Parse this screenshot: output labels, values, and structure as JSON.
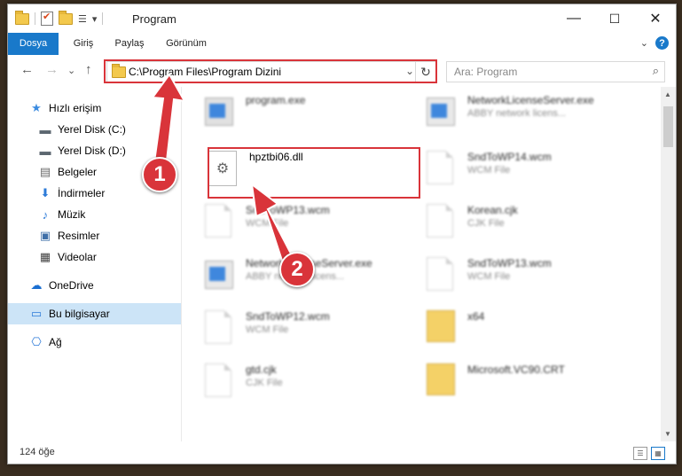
{
  "window": {
    "title": "Program",
    "controls": {
      "minimize": "—",
      "maximize": "☐",
      "close": "✕"
    }
  },
  "qat": {
    "dropdown": "▾"
  },
  "ribbon": {
    "tabs": [
      "Dosya",
      "Giriş",
      "Paylaş",
      "Görünüm"
    ],
    "collapse": "⌄",
    "help": "?"
  },
  "nav": {
    "back": "←",
    "forward": "→",
    "recent": "⌄",
    "up": "↑",
    "address": "C:\\Program Files\\Program Dizini",
    "address_dropdown": "⌄",
    "refresh": "↻",
    "search_placeholder": "Ara: Program",
    "search_icon": "search-icon"
  },
  "sidebar": {
    "items": [
      {
        "label": "Hızlı erişim",
        "icon": "star-icon",
        "glyph": "★",
        "color": "#3b8be0",
        "pinned": false
      },
      {
        "label": "Yerel Disk (C:)",
        "icon": "drive-icon",
        "glyph": "▬",
        "color": "#5c6770",
        "pinned": true
      },
      {
        "label": "Yerel Disk (D:)",
        "icon": "drive-icon",
        "glyph": "▬",
        "color": "#5c6770",
        "pinned": true
      },
      {
        "label": "Belgeler",
        "icon": "documents-icon",
        "glyph": "▤",
        "color": "#6a6a6a",
        "pinned": true
      },
      {
        "label": "İndirmeler",
        "icon": "download-icon",
        "glyph": "⬇",
        "color": "#2d7bd8",
        "pinned": true
      },
      {
        "label": "Müzik",
        "icon": "music-icon",
        "glyph": "♪",
        "color": "#2d7bd8",
        "pinned": true
      },
      {
        "label": "Resimler",
        "icon": "pictures-icon",
        "glyph": "▣",
        "color": "#3f6fa8",
        "pinned": true
      },
      {
        "label": "Videolar",
        "icon": "video-icon",
        "glyph": "▦",
        "color": "#404040",
        "pinned": true
      },
      {
        "label": "OneDrive",
        "icon": "cloud-icon",
        "glyph": "☁",
        "color": "#1b6fd1",
        "pinned": false
      },
      {
        "label": "Bu bilgisayar",
        "icon": "computer-icon",
        "glyph": "▭",
        "color": "#2d7bd8",
        "pinned": false
      },
      {
        "label": "Ağ",
        "icon": "network-icon",
        "glyph": "⎔",
        "color": "#2d7bd8",
        "pinned": false
      }
    ],
    "pin_glyph": "📌"
  },
  "files": [
    {
      "name": "program.exe",
      "type": "",
      "kind": "exe-setup"
    },
    {
      "name": "NetworkLicenseServer.exe",
      "type": "ABBY network licens...",
      "kind": "exe"
    },
    {
      "name": "hpztbi06.dll",
      "type": "",
      "kind": "dll"
    },
    {
      "name": "SndToWP14.wcm",
      "type": "WCM File",
      "kind": "doc"
    },
    {
      "name": "SndToWP13.wcm",
      "type": "WCM File",
      "kind": "doc"
    },
    {
      "name": "Korean.cjk",
      "type": "CJK File",
      "kind": "doc"
    },
    {
      "name": "NetworkLicenseServer.exe",
      "type": "ABBY network licens...",
      "kind": "exe"
    },
    {
      "name": "SndToWP13.wcm",
      "type": "WCM File",
      "kind": "doc"
    },
    {
      "name": "SndToWP12.wcm",
      "type": "WCM File",
      "kind": "doc"
    },
    {
      "name": "x64",
      "type": "",
      "kind": "folder"
    },
    {
      "name": "gtd.cjk",
      "type": "CJK File",
      "kind": "doc"
    },
    {
      "name": "Microsoft.VC90.CRT",
      "type": "",
      "kind": "folder"
    }
  ],
  "status": {
    "count": "124 öğe"
  },
  "annotations": {
    "step1": "1",
    "step2": "2",
    "color": "#d9343a"
  }
}
